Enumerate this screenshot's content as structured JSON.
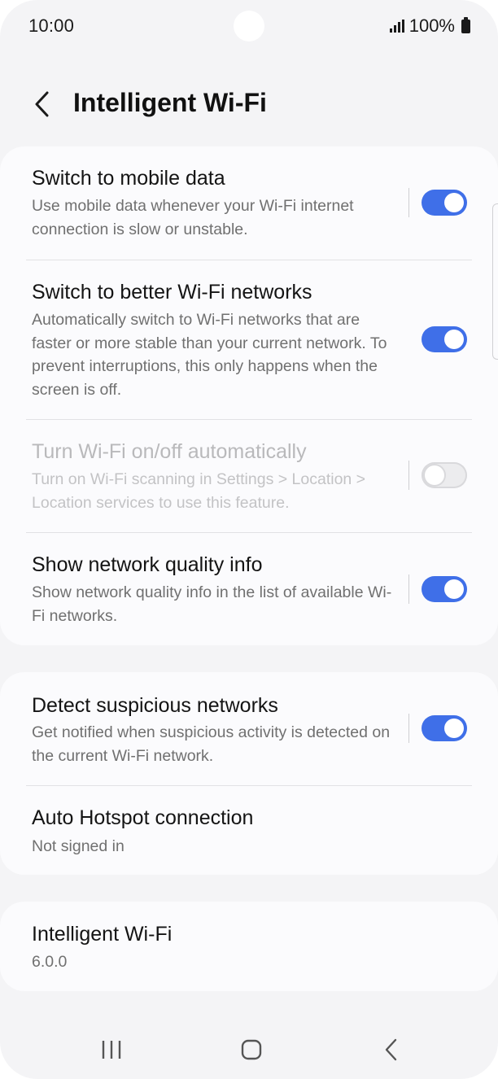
{
  "status_bar": {
    "time": "10:00",
    "battery": "100%"
  },
  "header": {
    "title": "Intelligent Wi-Fi",
    "back_icon": "chevron-left-icon"
  },
  "settings_group_1": [
    {
      "title": "Switch to mobile data",
      "description": "Use mobile data whenever your Wi-Fi internet connection is slow or unstable.",
      "toggle_on": true,
      "enabled": true
    },
    {
      "title": "Switch to better Wi-Fi networks",
      "description": "Automatically switch to Wi-Fi networks that are faster or more stable than your current network. To prevent interruptions, this only happens when the screen is off.",
      "toggle_on": true,
      "enabled": true
    },
    {
      "title": "Turn Wi-Fi on/off automatically",
      "description": "Turn on Wi-Fi scanning in Settings > Location > Location services to use this feature.",
      "toggle_on": false,
      "enabled": false
    },
    {
      "title": "Show network quality info",
      "description": "Show network quality info in the list of available Wi-Fi networks.",
      "toggle_on": true,
      "enabled": true
    }
  ],
  "settings_group_2": [
    {
      "title": "Detect suspicious networks",
      "description": "Get notified when suspicious activity is detected on the current Wi-Fi network.",
      "toggle_on": true,
      "enabled": true
    },
    {
      "title": "Auto Hotspot connection",
      "description": "Not signed in"
    }
  ],
  "about": {
    "title": "Intelligent Wi-Fi",
    "version": "6.0.0"
  },
  "nav_bar": {
    "recents_icon": "recents-icon",
    "home_icon": "home-icon",
    "back_icon": "back-icon"
  },
  "colors": {
    "accent": "#3f6fe8",
    "background": "#f4f4f6",
    "card": "#fbfbfd"
  }
}
